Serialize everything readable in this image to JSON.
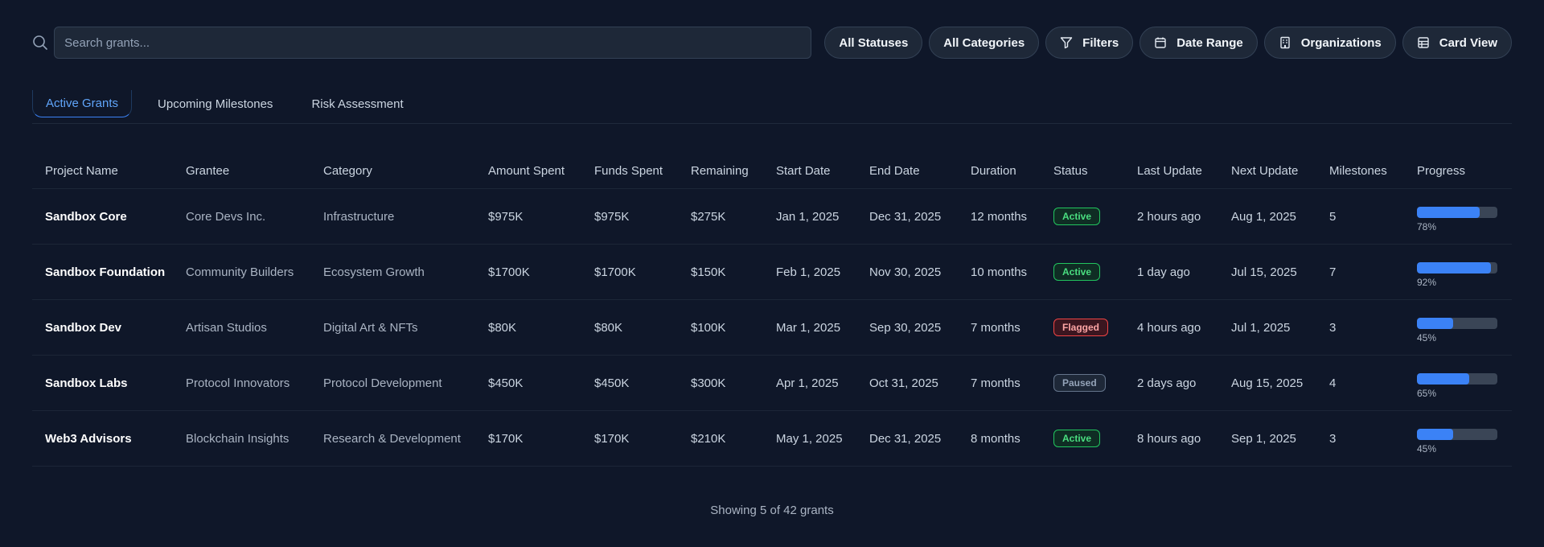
{
  "search": {
    "placeholder": "Search grants..."
  },
  "filters": [
    {
      "label": "All Statuses",
      "icon": ""
    },
    {
      "label": "All Categories",
      "icon": ""
    },
    {
      "label": "Filters",
      "icon": "filter-icon"
    },
    {
      "label": "Date Range",
      "icon": "calendar-icon"
    },
    {
      "label": "Organizations",
      "icon": "building-icon"
    },
    {
      "label": "Card View",
      "icon": "grid-icon"
    }
  ],
  "tabs": [
    {
      "label": "Active Grants",
      "active": true
    },
    {
      "label": "Upcoming Milestones",
      "active": false
    },
    {
      "label": "Risk Assessment",
      "active": false
    }
  ],
  "table": {
    "headers": [
      "Project Name",
      "Grantee",
      "Category",
      "Amount Spent",
      "Funds Spent",
      "Remaining",
      "Start Date",
      "End Date",
      "Duration",
      "Status",
      "Last Update",
      "Next Update",
      "Milestones",
      "Progress"
    ],
    "rows": [
      {
        "project": "Sandbox Core",
        "grantee": "Core Devs Inc.",
        "category": "Infrastructure",
        "amount": "$975K",
        "funds": "$975K",
        "remaining": "$275K",
        "start": "Jan 1, 2025",
        "end": "Dec 31, 2025",
        "duration": "12 months",
        "status": "Active",
        "status_type": "active",
        "last": "2 hours ago",
        "next": "Aug 1, 2025",
        "milestones": "5",
        "progress": 78,
        "progress_label": "78%"
      },
      {
        "project": "Sandbox Foundation",
        "grantee": "Community Builders",
        "category": "Ecosystem Growth",
        "amount": "$1700K",
        "funds": "$1700K",
        "remaining": "$150K",
        "start": "Feb 1, 2025",
        "end": "Nov 30, 2025",
        "duration": "10 months",
        "status": "Active",
        "status_type": "active",
        "last": "1 day ago",
        "next": "Jul 15, 2025",
        "milestones": "7",
        "progress": 92,
        "progress_label": "92%"
      },
      {
        "project": "Sandbox Dev",
        "grantee": "Artisan Studios",
        "category": "Digital Art & NFTs",
        "amount": "$80K",
        "funds": "$80K",
        "remaining": "$100K",
        "start": "Mar 1, 2025",
        "end": "Sep 30, 2025",
        "duration": "7 months",
        "status": "Flagged",
        "status_type": "flagged",
        "last": "4 hours ago",
        "next": "Jul 1, 2025",
        "milestones": "3",
        "progress": 45,
        "progress_label": "45%"
      },
      {
        "project": "Sandbox Labs",
        "grantee": "Protocol Innovators",
        "category": "Protocol Development",
        "amount": "$450K",
        "funds": "$450K",
        "remaining": "$300K",
        "start": "Apr 1, 2025",
        "end": "Oct 31, 2025",
        "duration": "7 months",
        "status": "Paused",
        "status_type": "paused",
        "last": "2 days ago",
        "next": "Aug 15, 2025",
        "milestones": "4",
        "progress": 65,
        "progress_label": "65%"
      },
      {
        "project": "Web3 Advisors",
        "grantee": "Blockchain Insights",
        "category": "Research & Development",
        "amount": "$170K",
        "funds": "$170K",
        "remaining": "$210K",
        "start": "May 1, 2025",
        "end": "Dec 31, 2025",
        "duration": "8 months",
        "status": "Active",
        "status_type": "active",
        "last": "8 hours ago",
        "next": "Sep 1, 2025",
        "milestones": "3",
        "progress": 45,
        "progress_label": "45%"
      }
    ]
  },
  "footer": {
    "text": "Showing 5 of 42 grants"
  },
  "colors": {
    "accent": "#3b82f6",
    "background": "#0f1729",
    "active": "#22c55e",
    "flagged": "#ef4444",
    "paused": "#64748b"
  }
}
